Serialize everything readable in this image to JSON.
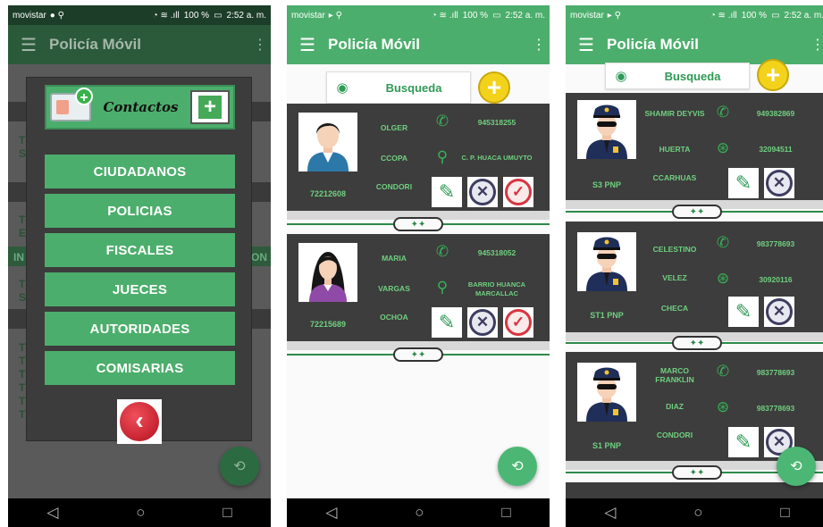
{
  "status": {
    "carrier": "movistar",
    "battery": "100 %",
    "time": "2:52 a. m."
  },
  "app": {
    "title": "Policía Móvil"
  },
  "icons": {
    "menu": "hamburger-menu-icon",
    "more": "overflow-menu-icon",
    "fab": "refresh-icon",
    "nav_back": "◁",
    "nav_home": "○",
    "nav_recent": "□"
  },
  "colors": {
    "primary": "#4cae6c",
    "dark": "#3d3d3d",
    "accent_text": "#6fd07f",
    "yellow": "#f3d21b"
  },
  "screen1": {
    "dialog_title": "Contactos",
    "menu": [
      "CIUDADANOS",
      "POLICIAS",
      "FISCALES",
      "JUECES",
      "AUTORIDADES",
      "COMISARIAS"
    ],
    "background_letters": [
      "T",
      "S",
      "T",
      "E",
      "IN",
      "ON",
      "T",
      "S",
      "T",
      "T",
      "T",
      "T",
      "T",
      "T"
    ]
  },
  "screen2": {
    "search_label": "Busqueda",
    "contacts": [
      {
        "name": "OLGER",
        "surname1": "CCOPA",
        "surname2": "CONDORI",
        "id": "72212608",
        "phone": "945318255",
        "address": "C. P. HUACA UMUYTO"
      },
      {
        "name": "MARIA",
        "surname1": "VARGAS",
        "surname2": "OCHOA",
        "id": "72215689",
        "phone": "945318052",
        "address": "BARRIO HUANCA MARCALLAC"
      }
    ]
  },
  "screen3": {
    "search_label": "Busqueda",
    "officers": [
      {
        "line1": "SHAMIR DEYVIS",
        "line2": "HUERTA",
        "line3": "CCARHUAS",
        "rank": "S3 PNP",
        "phone": "949382869",
        "code": "32094511"
      },
      {
        "line1": "CELESTINO",
        "line2": "VELEZ",
        "line3": "CHECA",
        "rank": "ST1 PNP",
        "phone": "983778693",
        "code": "30920116"
      },
      {
        "line1": "MARCO FRANKLIN",
        "line2": "DIAZ",
        "line3": "CONDORI",
        "rank": "S1 PNP",
        "phone": "983778693",
        "code": "983778693"
      }
    ]
  }
}
